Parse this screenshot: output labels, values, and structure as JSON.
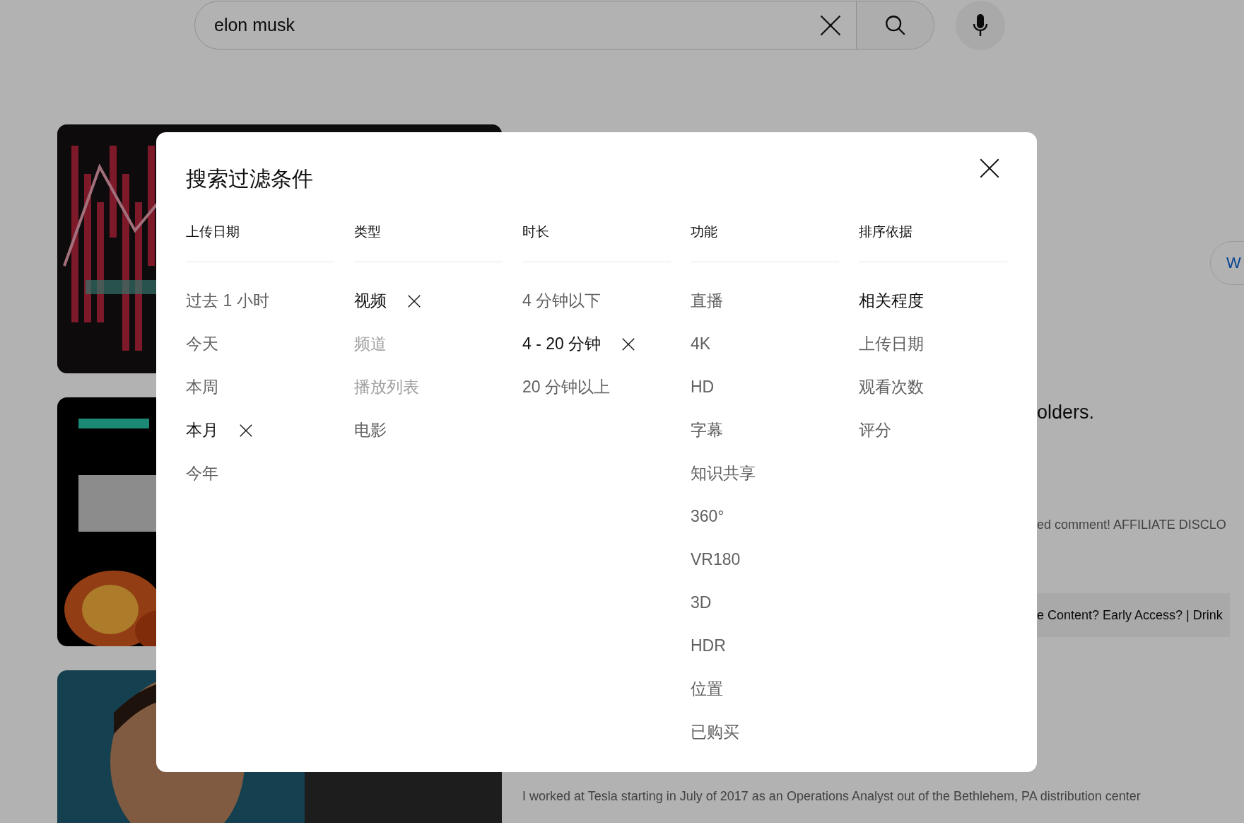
{
  "search": {
    "value": "elon musk"
  },
  "results": [
    {
      "thumbnail": {
        "kind": "picture"
      }
    },
    {
      "thumbnail": {
        "kind": "picture"
      },
      "title": "olders.",
      "description": "ed comment! AFFILIATE DISCLO",
      "chip": "e Content? Early Access? | Drink"
    },
    {
      "thumbnail": {
        "kind": "picture"
      },
      "description": "I worked at Tesla starting in July of 2017 as an Operations Analyst out of the Bethlehem, PA distribution center"
    }
  ],
  "side_button": "W",
  "dialog": {
    "title": "搜索过滤条件",
    "columns": [
      {
        "heading": "上传日期",
        "kind": "filter",
        "items": [
          {
            "label": "过去 1 小时",
            "selected": false,
            "disabled": false
          },
          {
            "label": "今天",
            "selected": false,
            "disabled": false
          },
          {
            "label": "本周",
            "selected": false,
            "disabled": false
          },
          {
            "label": "本月",
            "selected": true,
            "disabled": false
          },
          {
            "label": "今年",
            "selected": false,
            "disabled": false
          }
        ]
      },
      {
        "heading": "类型",
        "kind": "filter",
        "items": [
          {
            "label": "视频",
            "selected": true,
            "disabled": false
          },
          {
            "label": "频道",
            "selected": false,
            "disabled": true
          },
          {
            "label": "播放列表",
            "selected": false,
            "disabled": true
          },
          {
            "label": "电影",
            "selected": false,
            "disabled": false
          }
        ]
      },
      {
        "heading": "时长",
        "kind": "filter",
        "items": [
          {
            "label": "4 分钟以下",
            "selected": false,
            "disabled": false
          },
          {
            "label": "4 - 20 分钟",
            "selected": true,
            "disabled": false
          },
          {
            "label": "20 分钟以上",
            "selected": false,
            "disabled": false
          }
        ]
      },
      {
        "heading": "功能",
        "kind": "filter",
        "items": [
          {
            "label": "直播",
            "selected": false,
            "disabled": false
          },
          {
            "label": "4K",
            "selected": false,
            "disabled": false
          },
          {
            "label": "HD",
            "selected": false,
            "disabled": false
          },
          {
            "label": "字幕",
            "selected": false,
            "disabled": false
          },
          {
            "label": "知识共享",
            "selected": false,
            "disabled": false
          },
          {
            "label": "360°",
            "selected": false,
            "disabled": false
          },
          {
            "label": "VR180",
            "selected": false,
            "disabled": false
          },
          {
            "label": "3D",
            "selected": false,
            "disabled": false
          },
          {
            "label": "HDR",
            "selected": false,
            "disabled": false
          },
          {
            "label": "位置",
            "selected": false,
            "disabled": false
          },
          {
            "label": "已购买",
            "selected": false,
            "disabled": false
          }
        ]
      },
      {
        "heading": "排序依据",
        "kind": "sort",
        "items": [
          {
            "label": "相关程度",
            "selected": true,
            "disabled": false
          },
          {
            "label": "上传日期",
            "selected": false,
            "disabled": false
          },
          {
            "label": "观看次数",
            "selected": false,
            "disabled": false
          },
          {
            "label": "评分",
            "selected": false,
            "disabled": false
          }
        ]
      }
    ]
  }
}
